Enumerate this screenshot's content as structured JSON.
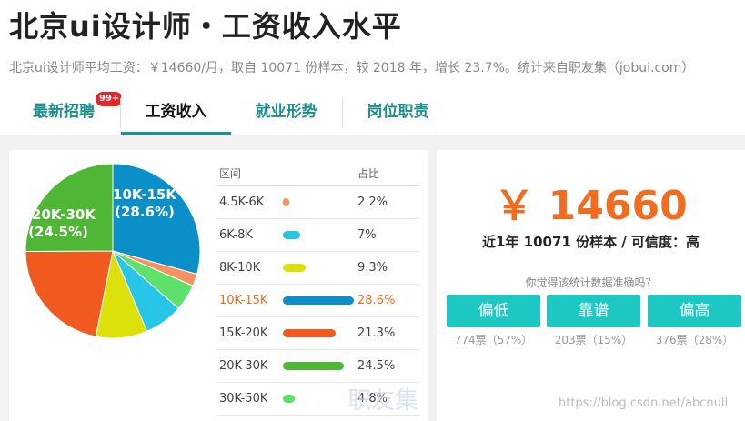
{
  "header": {
    "title": "北京ui设计师・工资收入水平",
    "subtitle": "北京ui设计师平均工资：￥14660/月，取自 10071 份样本，较 2018 年，增长 23.7%。统计来自职友集（jobui.com）"
  },
  "tabs": [
    {
      "label": "最新招聘",
      "badge": "99+"
    },
    {
      "label": "工资收入",
      "active": true
    },
    {
      "label": "就业形势"
    },
    {
      "label": "岗位职责"
    }
  ],
  "pie": {
    "label_big": {
      "range": "10K-15K",
      "pct": "(28.6%)"
    },
    "label_small": {
      "range": "20K-30K",
      "pct": "(24.5%)"
    }
  },
  "table": {
    "col_range": "区间",
    "col_pct": "占比",
    "highlight": "10K-15K"
  },
  "chart_data": {
    "type": "pie",
    "categories": [
      "4.5K-6K",
      "6K-8K",
      "8K-10K",
      "10K-15K",
      "15K-20K",
      "20K-30K",
      "30K-50K"
    ],
    "values": [
      2.2,
      7,
      9.3,
      28.6,
      21.3,
      24.5,
      4.8
    ],
    "labels": [
      "2.2%",
      "7%",
      "9.3%",
      "28.6%",
      "21.3%",
      "24.5%",
      "4.8%"
    ],
    "colors": [
      "#f6925f",
      "#28c6e6",
      "#dde10a",
      "#0a8fc9",
      "#f05a1e",
      "#4fb636",
      "#5ee16a"
    ]
  },
  "summary": {
    "salary": "￥ 14660",
    "meta": "近1年 10071 份样本 / 可信度：高",
    "question": "你觉得该统计数据准确吗？"
  },
  "votes": [
    {
      "label": "偏低",
      "count": "774票（57%）"
    },
    {
      "label": "靠谱",
      "count": "203票（15%）"
    },
    {
      "label": "偏高",
      "count": "376票（28%）"
    }
  ],
  "watermarks": {
    "site": "职友集",
    "blog": "https://blog.csdn.net/abcnull"
  },
  "colors": {
    "accent": "#1ec8c2",
    "salary": "#f26b1f",
    "tab_text": "#1b8f8a"
  }
}
